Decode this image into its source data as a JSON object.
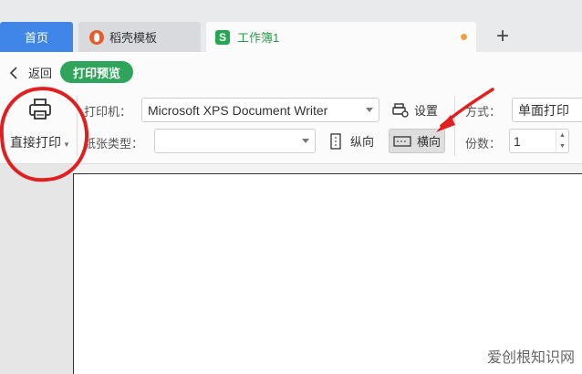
{
  "tabs": {
    "home": "首页",
    "template": "稻壳模板",
    "workbook": "工作簿1",
    "add": "+"
  },
  "header": {
    "back": "返回",
    "mode": "打印预览"
  },
  "print": {
    "direct_print": "直接打印",
    "printer_label": "打印机：",
    "printer_value": "Microsoft XPS Document Writer",
    "settings": "设置",
    "paper_label": "纸张类型：",
    "paper_value": "",
    "portrait": "纵向",
    "landscape": "横向",
    "method_label": "方式：",
    "method_value": "单面打印",
    "copies_label": "份数：",
    "copies_value": "1"
  },
  "colors": {
    "accent_blue": "#3f86e8",
    "accent_green": "#2ea55b",
    "annotation_red": "#e02020"
  },
  "icons": [
    "chevron-left-icon",
    "printer-icon",
    "settings-icon",
    "portrait-icon",
    "landscape-icon",
    "plus-icon"
  ],
  "watermark": "爱创根知识网"
}
